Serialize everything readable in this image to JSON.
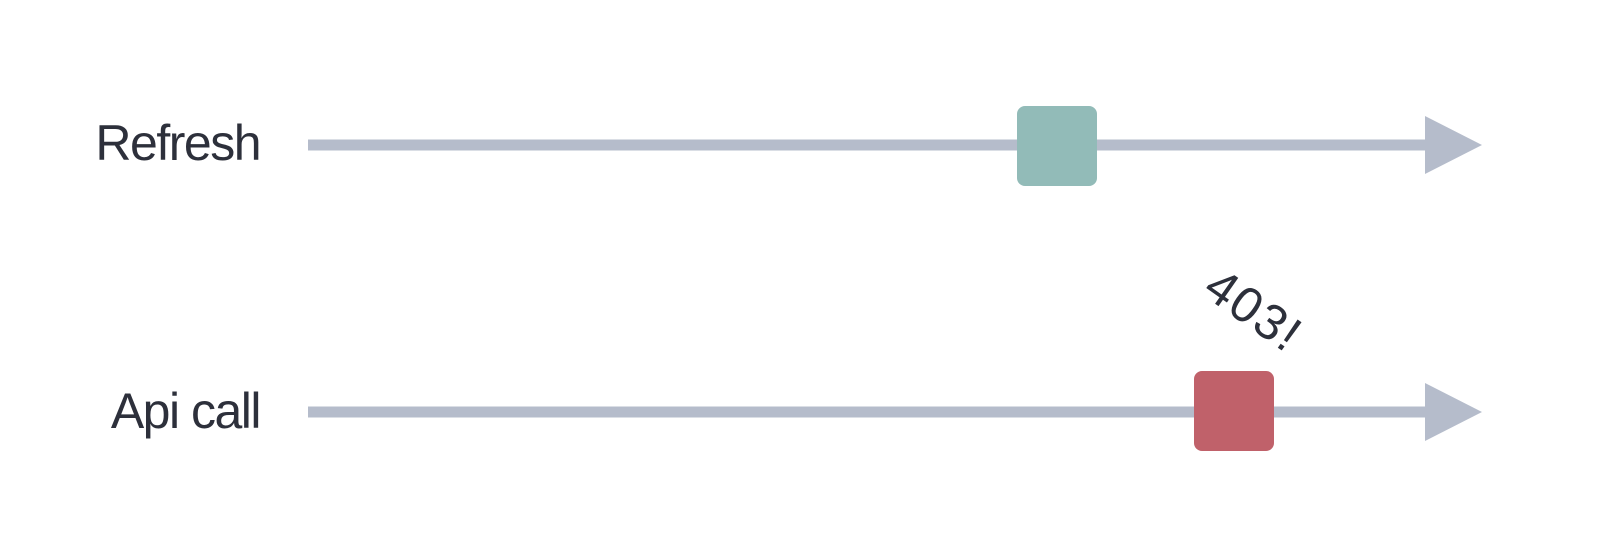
{
  "colors": {
    "background": "#ffffff",
    "text": "#2d303b",
    "line": "#b5bccb",
    "refresh_marker": "#92bbb8",
    "api_marker": "#c0616a"
  },
  "lanes": [
    {
      "label": "Refresh",
      "marker_color": "#92bbb8",
      "annotation": ""
    },
    {
      "label": "Api call",
      "marker_color": "#c0616a",
      "annotation": "403!"
    }
  ]
}
